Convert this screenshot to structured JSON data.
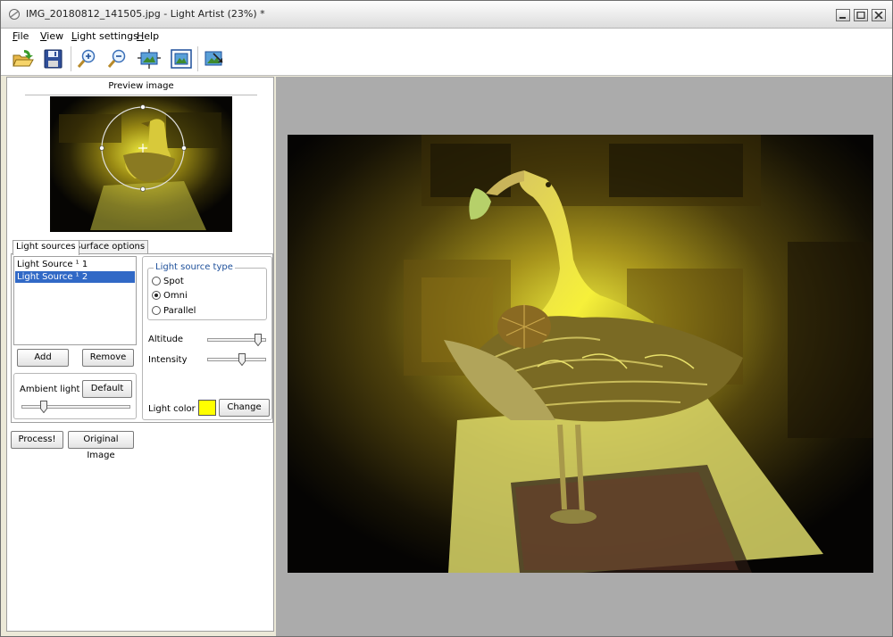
{
  "window": {
    "title": "IMG_20180812_141505.jpg - Light Artist (23%) *"
  },
  "menu": {
    "file": {
      "accel": "F",
      "rest": "ile"
    },
    "view": {
      "accel": "V",
      "rest": "iew"
    },
    "light_settings": {
      "accel": "L",
      "rest": "ight settings"
    },
    "help": {
      "accel": "H",
      "rest": "elp"
    }
  },
  "toolbar": {
    "icons": [
      "open-folder-icon",
      "save-disk-icon",
      "zoom-in-icon",
      "zoom-out-icon",
      "fit-window-icon",
      "actual-size-icon",
      "export-image-icon"
    ]
  },
  "preview": {
    "label": "Preview image"
  },
  "tabs": [
    {
      "label": "Light sources",
      "active": true
    },
    {
      "label": "Surface options",
      "active": false
    }
  ],
  "light_sources": {
    "items": [
      {
        "label": "Light Source ¹ 1",
        "selected": false
      },
      {
        "label": "Light Source ¹ 2",
        "selected": true
      }
    ],
    "add_label": "Add",
    "remove_label": "Remove"
  },
  "ambient": {
    "label": "Ambient light",
    "default_label": "Default",
    "level": 0.18
  },
  "source_type": {
    "legend": "Light source type",
    "options": [
      {
        "label": "Spot",
        "selected": false
      },
      {
        "label": "Omni",
        "selected": true
      },
      {
        "label": "Parallel",
        "selected": false
      }
    ]
  },
  "altitude": {
    "label": "Altitude",
    "level": 0.92
  },
  "intensity": {
    "label": "Intensity",
    "level": 0.6
  },
  "light_color": {
    "label": "Light color",
    "value": "#ffff00",
    "change_label": "Change"
  },
  "actions": {
    "process_label": "Process!",
    "original_label": "Original Image"
  },
  "colors": {
    "selection": "#3169c6",
    "viewer_bg": "#ababab",
    "accent_yellow": "#ffff00"
  }
}
